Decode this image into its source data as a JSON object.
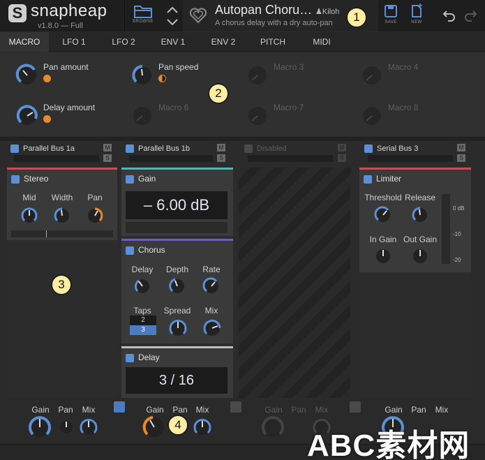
{
  "header": {
    "app_name": "snapheap",
    "version": "v1.8.0 — Full",
    "browse_label": "BROWSE",
    "preset_name": "Autopan Choru…",
    "preset_author": "Kiloh",
    "preset_description": "A chorus delay with a dry auto-pan",
    "save_label": "SAVE",
    "new_label": "NEW"
  },
  "annotations": [
    "1",
    "2",
    "3",
    "4"
  ],
  "tabs": [
    "MACRO",
    "LFO 1",
    "LFO 2",
    "ENV 1",
    "ENV 2",
    "PITCH",
    "MIDI"
  ],
  "macros": [
    {
      "label": "Pan amount"
    },
    {
      "label": "Pan speed"
    },
    {
      "label": "Macro 3"
    },
    {
      "label": "Macro 4"
    },
    {
      "label": "Delay amount"
    },
    {
      "label": "Macro 6"
    },
    {
      "label": "Macro 7"
    },
    {
      "label": "Macro 8"
    }
  ],
  "buses": [
    {
      "name": "Parallel Bus 1a"
    },
    {
      "name": "Parallel Bus 1b"
    },
    {
      "name": "Disabled"
    },
    {
      "name": "Serial Bus 3"
    }
  ],
  "mute_label": "M",
  "solo_label": "S",
  "modules": {
    "stereo": {
      "title": "Stereo",
      "mid": "Mid",
      "width": "Width",
      "pan": "Pan"
    },
    "gain": {
      "title": "Gain",
      "value": "–  6.00 dB"
    },
    "chorus": {
      "title": "Chorus",
      "delay": "Delay",
      "depth": "Depth",
      "rate": "Rate",
      "taps": "Taps",
      "taps_value": "2",
      "taps_selected": "3",
      "spread": "Spread",
      "mix": "Mix"
    },
    "delay": {
      "title": "Delay",
      "value": "3 / 16"
    },
    "limiter": {
      "title": "Limiter",
      "threshold": "Threshold",
      "release": "Release",
      "in_gain": "In Gain",
      "out_gain": "Out Gain",
      "meter_ticks": [
        "0 dB",
        "-10",
        "-20"
      ]
    }
  },
  "bottom": {
    "gain": "Gain",
    "pan": "Pan",
    "mix": "Mix"
  },
  "watermark": "ABC素材网",
  "colors": {
    "accent_blue": "#5b8fd6",
    "accent_orange": "#e88a2c",
    "gain_bar": "#5fb0b0",
    "chorus_bar": "#6c5fb0",
    "delay_bar": "#bdbdbd",
    "limiter_bar": "#c2505a"
  }
}
